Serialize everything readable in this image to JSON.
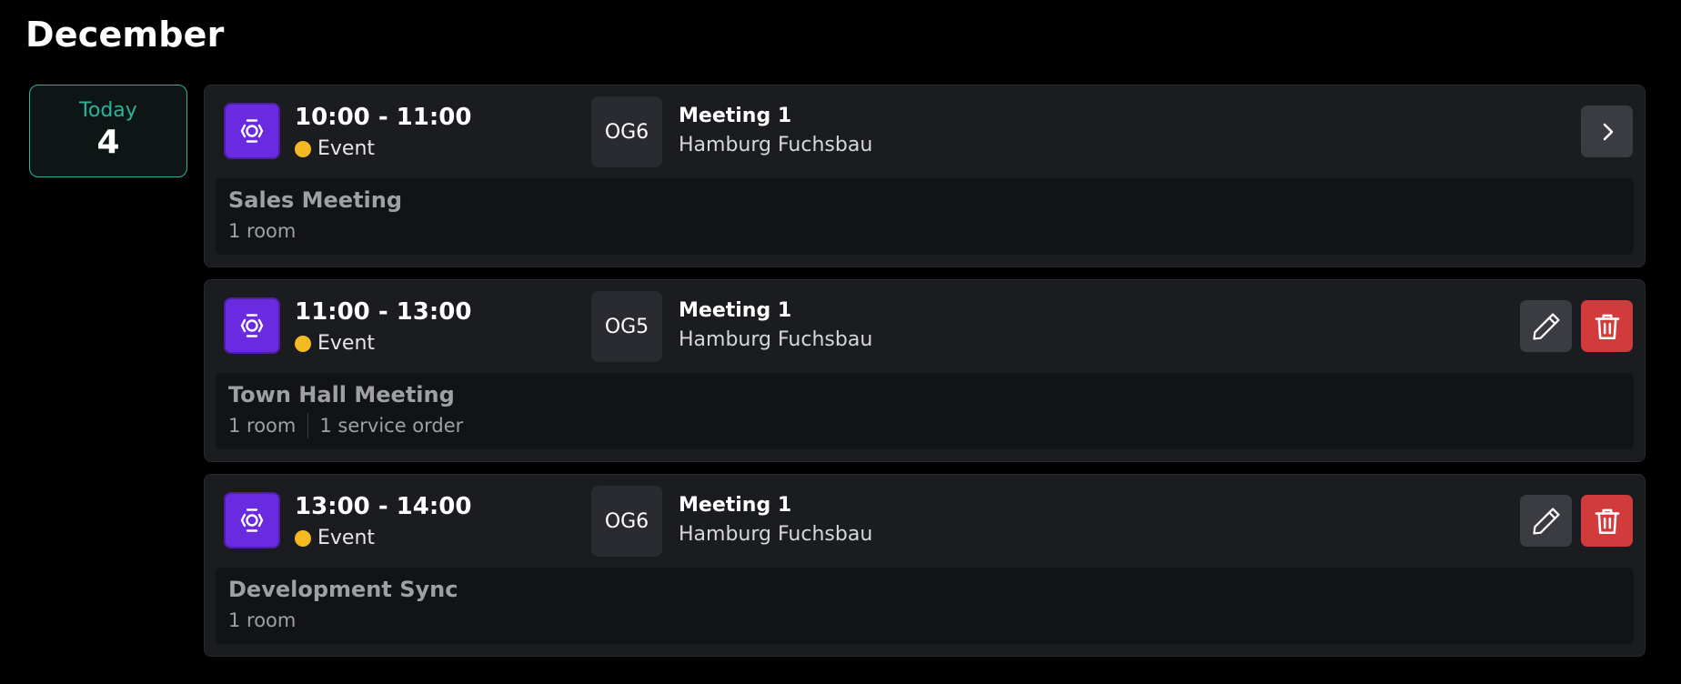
{
  "header": {
    "month": "December"
  },
  "day": {
    "label": "Today",
    "number": "4"
  },
  "colors": {
    "accent_teal": "#2bb39a",
    "event_icon_purple": "#6a2be0",
    "status_yellow": "#f5b921",
    "delete_red": "#d23b3b"
  },
  "events": [
    {
      "time": "10:00 - 11:00",
      "kind": "Event",
      "room_code": "OG6",
      "room_name": "Meeting 1",
      "location": "Hamburg Fuchsbau",
      "title": "Sales Meeting",
      "meta": [
        "1 room"
      ],
      "actions": [
        "chevron-right-icon"
      ]
    },
    {
      "time": "11:00 - 13:00",
      "kind": "Event",
      "room_code": "OG5",
      "room_name": "Meeting 1",
      "location": "Hamburg Fuchsbau",
      "title": "Town Hall Meeting",
      "meta": [
        "1 room",
        "1 service order"
      ],
      "actions": [
        "pencil-icon",
        "trash-icon"
      ]
    },
    {
      "time": "13:00 - 14:00",
      "kind": "Event",
      "room_code": "OG6",
      "room_name": "Meeting 1",
      "location": "Hamburg Fuchsbau",
      "title": "Development Sync",
      "meta": [
        "1 room"
      ],
      "actions": [
        "pencil-icon",
        "trash-icon"
      ]
    }
  ]
}
